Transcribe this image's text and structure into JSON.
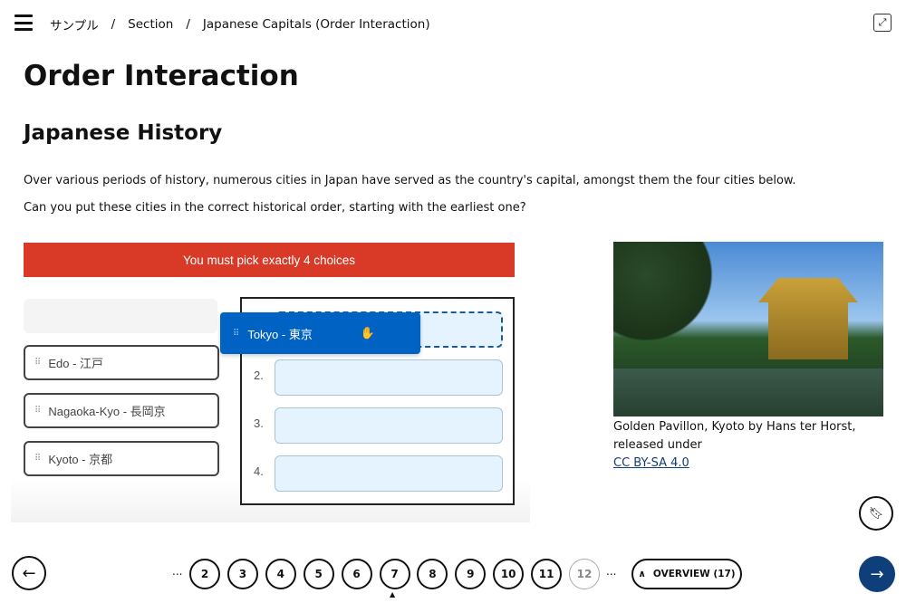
{
  "header": {
    "breadcrumb": [
      "サンプル",
      "Section",
      "Japanese Capitals (Order Interaction)"
    ],
    "separator": "/"
  },
  "page_title": "Order Interaction",
  "section_title": "Japanese History",
  "paragraphs": [
    "Over various periods of history, numerous cities in Japan have served as the country's capital, amongst them the four cities below.",
    "Can you put these cities in the correct historical order, starting with the earliest one?"
  ],
  "quiz": {
    "error": "You must pick exactly 4 choices",
    "choices": [
      "Edo - 江戸",
      "Nagaoka-Kyo - 長岡京",
      "Kyoto - 京都"
    ],
    "dragging": "Tokyo - 東京",
    "slot_numbers": [
      "2.",
      "3.",
      "4."
    ],
    "colors": {
      "error": "#d93a27",
      "drag": "#0062c2",
      "slot": "#e4f3fd"
    }
  },
  "image": {
    "caption": "Golden Pavillon, Kyoto by Hans ter Horst, released under",
    "license": "CC BY-SA 4.0"
  },
  "pagination": {
    "pages": [
      "2",
      "3",
      "4",
      "5",
      "6",
      "7",
      "8",
      "9",
      "10",
      "11",
      "12"
    ],
    "current": "7",
    "ellipsis": "...",
    "overview": "OVERVIEW (17)",
    "next_color": "#0f3f7a"
  }
}
